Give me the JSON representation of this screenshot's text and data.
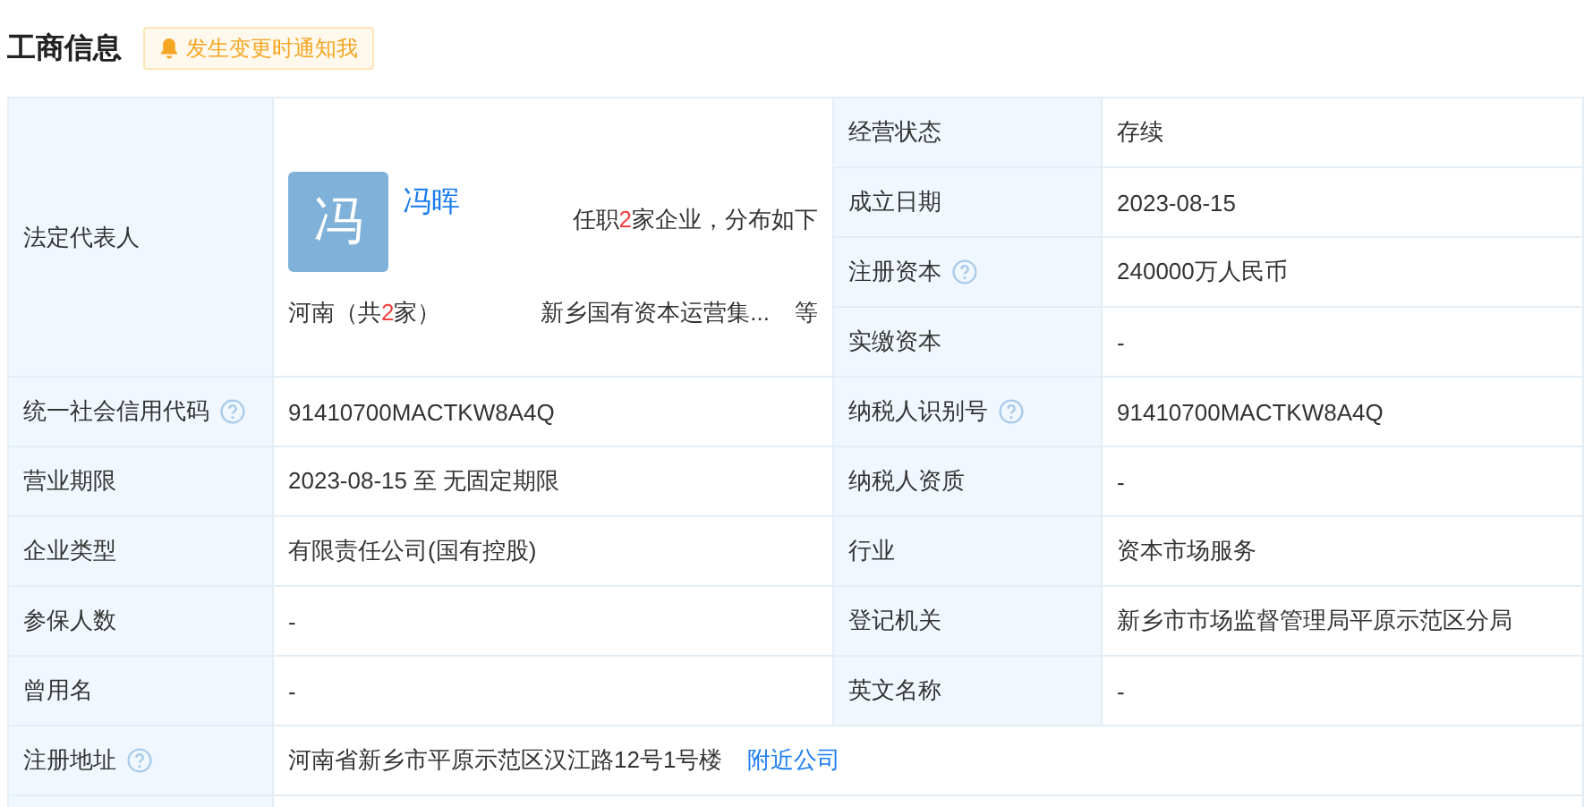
{
  "section_title": "工商信息",
  "notify_button": "发生变更时通知我",
  "legal_rep": {
    "label": "法定代表人",
    "avatar": "冯",
    "name": "冯晖",
    "positions": {
      "before": "任职",
      "count": "2",
      "after": "家企业，分布如下"
    },
    "region": {
      "before": "河南（共",
      "count": "2",
      "after": "家）"
    },
    "company": "新乡国有资本运营集...",
    "more": "等"
  },
  "side_rows": [
    {
      "label": "经营状态",
      "help": false,
      "value": "存续"
    },
    {
      "label": "成立日期",
      "help": false,
      "value": "2023-08-15"
    },
    {
      "label": "注册资本",
      "help": true,
      "value": "240000万人民币"
    },
    {
      "label": "实缴资本",
      "help": false,
      "value": "-"
    }
  ],
  "rows": [
    [
      {
        "label": "统一社会信用代码",
        "help": true,
        "value": "91410700MACTKW8A4Q"
      },
      {
        "label": "纳税人识别号",
        "help": true,
        "value": "91410700MACTKW8A4Q"
      }
    ],
    [
      {
        "label": "营业期限",
        "help": false,
        "value": "2023-08-15 至 无固定期限"
      },
      {
        "label": "纳税人资质",
        "help": false,
        "value": "-"
      }
    ],
    [
      {
        "label": "企业类型",
        "help": false,
        "value": "有限责任公司(国有控股)"
      },
      {
        "label": "行业",
        "help": false,
        "value": "资本市场服务"
      }
    ],
    [
      {
        "label": "参保人数",
        "help": false,
        "value": "-"
      },
      {
        "label": "登记机关",
        "help": false,
        "value": "新乡市市场监督管理局平原示范区分局"
      }
    ],
    [
      {
        "label": "曾用名",
        "help": false,
        "value": "-"
      },
      {
        "label": "英文名称",
        "help": false,
        "value": "-"
      }
    ]
  ],
  "address": {
    "label": "注册地址",
    "help": true,
    "value": "河南省新乡市平原示范区汉江路12号1号楼",
    "link": "附近公司"
  }
}
